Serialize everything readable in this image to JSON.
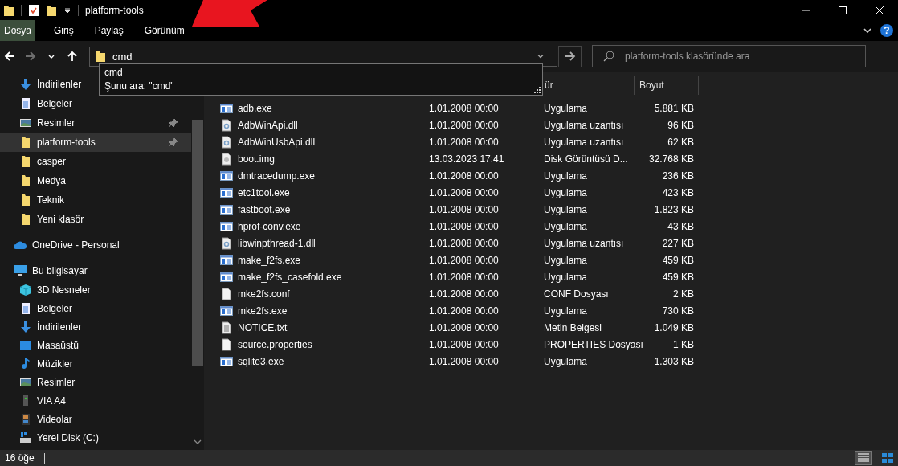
{
  "window": {
    "title": "platform-tools"
  },
  "ribbon": {
    "tabs": [
      {
        "label": "Dosya",
        "selected": true
      },
      {
        "label": "Giriş",
        "selected": false
      },
      {
        "label": "Paylaş",
        "selected": false
      },
      {
        "label": "Görünüm",
        "selected": false
      }
    ],
    "help_label": "?"
  },
  "navigation": {
    "buttons": [
      {
        "kind": "back",
        "disabled": false
      },
      {
        "kind": "forward",
        "disabled": true
      },
      {
        "kind": "recent",
        "disabled": false
      },
      {
        "kind": "up",
        "disabled": false
      }
    ],
    "address": {
      "value": "cmd"
    },
    "suggestions": [
      {
        "label": "cmd"
      },
      {
        "label": "Şunu ara: \"cmd\""
      }
    ],
    "search": {
      "placeholder": "platform-tools klasöründe ara"
    }
  },
  "sidebar": {
    "quick_access": [
      {
        "label": "İndirilenler",
        "kind": "download",
        "pinned": false,
        "selected": false
      },
      {
        "label": "Belgeler",
        "kind": "document",
        "pinned": false,
        "selected": false
      },
      {
        "label": "Resimler",
        "kind": "picture",
        "pinned": true,
        "selected": false
      },
      {
        "label": "platform-tools",
        "kind": "folder",
        "pinned": true,
        "selected": true
      },
      {
        "label": "casper",
        "kind": "folder",
        "pinned": false,
        "selected": false
      },
      {
        "label": "Medya",
        "kind": "folder",
        "pinned": false,
        "selected": false
      },
      {
        "label": "Teknik",
        "kind": "folder",
        "pinned": false,
        "selected": false
      },
      {
        "label": "Yeni klasör",
        "kind": "folder",
        "pinned": false,
        "selected": false
      }
    ],
    "roots": [
      {
        "label": "OneDrive - Personal",
        "kind": "cloud"
      },
      {
        "label": "Bu bilgisayar",
        "kind": "computer",
        "children": [
          {
            "label": "3D Nesneler",
            "kind": "cube"
          },
          {
            "label": "Belgeler",
            "kind": "document"
          },
          {
            "label": "İndirilenler",
            "kind": "download"
          },
          {
            "label": "Masaüstü",
            "kind": "desktop"
          },
          {
            "label": "Müzikler",
            "kind": "music"
          },
          {
            "label": "Resimler",
            "kind": "picture"
          },
          {
            "label": "VIA A4",
            "kind": "phone"
          },
          {
            "label": "Videolar",
            "kind": "video"
          },
          {
            "label": "Yerel Disk (C:)",
            "kind": "disk"
          }
        ]
      }
    ]
  },
  "table": {
    "columns": [
      {
        "label": "ür"
      },
      {
        "label": "Boyut"
      }
    ],
    "rows": [
      {
        "name": "adb.exe",
        "modified": "1.01.2008 00:00",
        "type": "Uygulama",
        "size": "5.881 KB",
        "kind": "exe"
      },
      {
        "name": "AdbWinApi.dll",
        "modified": "1.01.2008 00:00",
        "type": "Uygulama uzantısı",
        "size": "96 KB",
        "kind": "dll"
      },
      {
        "name": "AdbWinUsbApi.dll",
        "modified": "1.01.2008 00:00",
        "type": "Uygulama uzantısı",
        "size": "62 KB",
        "kind": "dll"
      },
      {
        "name": "boot.img",
        "modified": "13.03.2023 17:41",
        "type": "Disk Görüntüsü D...",
        "size": "32.768 KB",
        "kind": "disc"
      },
      {
        "name": "dmtracedump.exe",
        "modified": "1.01.2008 00:00",
        "type": "Uygulama",
        "size": "236 KB",
        "kind": "exe"
      },
      {
        "name": "etc1tool.exe",
        "modified": "1.01.2008 00:00",
        "type": "Uygulama",
        "size": "423 KB",
        "kind": "exe"
      },
      {
        "name": "fastboot.exe",
        "modified": "1.01.2008 00:00",
        "type": "Uygulama",
        "size": "1.823 KB",
        "kind": "exe"
      },
      {
        "name": "hprof-conv.exe",
        "modified": "1.01.2008 00:00",
        "type": "Uygulama",
        "size": "43 KB",
        "kind": "exe"
      },
      {
        "name": "libwinpthread-1.dll",
        "modified": "1.01.2008 00:00",
        "type": "Uygulama uzantısı",
        "size": "227 KB",
        "kind": "dll"
      },
      {
        "name": "make_f2fs.exe",
        "modified": "1.01.2008 00:00",
        "type": "Uygulama",
        "size": "459 KB",
        "kind": "exe"
      },
      {
        "name": "make_f2fs_casefold.exe",
        "modified": "1.01.2008 00:00",
        "type": "Uygulama",
        "size": "459 KB",
        "kind": "exe"
      },
      {
        "name": "mke2fs.conf",
        "modified": "1.01.2008 00:00",
        "type": "CONF Dosyası",
        "size": "2 KB",
        "kind": "blank"
      },
      {
        "name": "mke2fs.exe",
        "modified": "1.01.2008 00:00",
        "type": "Uygulama",
        "size": "730 KB",
        "kind": "exe"
      },
      {
        "name": "NOTICE.txt",
        "modified": "1.01.2008 00:00",
        "type": "Metin Belgesi",
        "size": "1.049 KB",
        "kind": "text"
      },
      {
        "name": "source.properties",
        "modified": "1.01.2008 00:00",
        "type": "PROPERTIES Dosyası",
        "size": "1 KB",
        "kind": "blank"
      },
      {
        "name": "sqlite3.exe",
        "modified": "1.01.2008 00:00",
        "type": "Uygulama",
        "size": "1.303 KB",
        "kind": "exe"
      }
    ]
  },
  "status_bar": {
    "count": "16 öğe",
    "views": [
      {
        "kind": "details",
        "selected": true
      },
      {
        "kind": "tiles",
        "selected": false
      }
    ]
  }
}
